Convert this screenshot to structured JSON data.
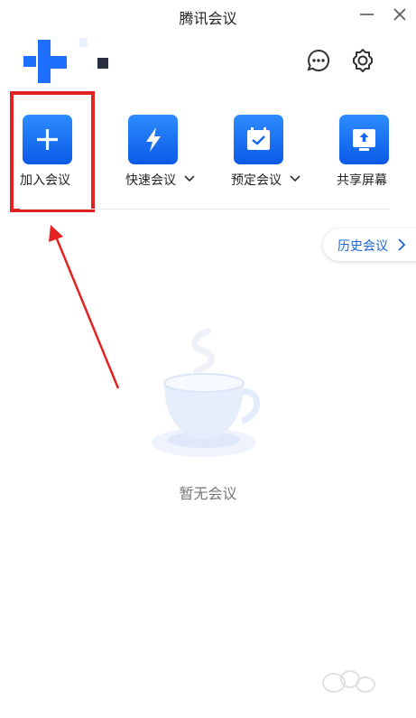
{
  "window": {
    "title": "腾讯会议",
    "minimize_icon": "minimize-icon",
    "close_icon": "close-icon"
  },
  "header": {
    "avatar_icon": "user-avatar-pixel-icon",
    "chat_icon": "chat-bubble-icon",
    "settings_icon": "gear-icon"
  },
  "actions": [
    {
      "label": "加入会议",
      "icon": "plus-icon",
      "has_dropdown": false,
      "highlighted": true
    },
    {
      "label": "快速会议",
      "icon": "lightning-icon",
      "has_dropdown": true
    },
    {
      "label": "预定会议",
      "icon": "calendar-check-icon",
      "has_dropdown": true
    },
    {
      "label": "共享屏幕",
      "icon": "screen-share-icon",
      "has_dropdown": false
    }
  ],
  "history": {
    "label": "历史会议"
  },
  "empty_state": {
    "text": "暂无会议",
    "icon": "coffee-cup-icon"
  },
  "annotation": {
    "highlight_color": "#e32222",
    "arrow_color": "#e32222"
  },
  "colors": {
    "accent": "#1a64d6",
    "tile_top": "#2d8cff",
    "tile_bottom": "#0a5ae6"
  }
}
